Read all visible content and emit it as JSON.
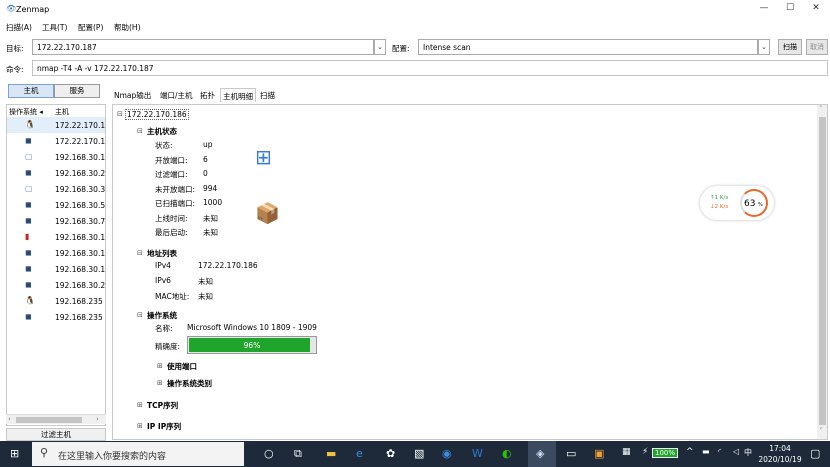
{
  "window": {
    "title": "Zenmap",
    "minimize": "—",
    "maximize": "☐",
    "close": "✕"
  },
  "menu": {
    "scan": "扫描(A)",
    "tools": "工具(T)",
    "profile": "配置(P)",
    "help": "帮助(H)"
  },
  "scanbar": {
    "target_label": "目标:",
    "target_value": "172.22.170.187",
    "profile_label": "配置:",
    "profile_value": "Intense scan",
    "scan_button": "扫描",
    "cancel_button": "取消",
    "command_label": "命令:",
    "command_value": "nmap -T4 -A -v 172.22.170.187"
  },
  "left": {
    "hosts_tab": "主机",
    "services_tab": "服务",
    "col_os": "操作系统",
    "col_host": "主机",
    "hosts": [
      {
        "icon": "linux-icon",
        "glyph": "🐧",
        "ip": "172.22.170.1"
      },
      {
        "icon": "windows-icon",
        "glyph": "◼",
        "ip": "172.22.170.1"
      },
      {
        "icon": "generic-icon",
        "glyph": "▢",
        "ip": "192.168.30.1"
      },
      {
        "icon": "windows-icon",
        "glyph": "◼",
        "ip": "192.168.30.2"
      },
      {
        "icon": "generic-icon",
        "glyph": "▢",
        "ip": "192.168.30.3"
      },
      {
        "icon": "windows-icon",
        "glyph": "◼",
        "ip": "192.168.30.5"
      },
      {
        "icon": "windows-icon",
        "glyph": "◼",
        "ip": "192.168.30.7"
      },
      {
        "icon": "redhat-icon",
        "glyph": "▮",
        "ip": "192.168.30.1"
      },
      {
        "icon": "windows-icon",
        "glyph": "◼",
        "ip": "192.168.30.1"
      },
      {
        "icon": "windows-icon",
        "glyph": "◼",
        "ip": "192.168.30.1"
      },
      {
        "icon": "windows-icon",
        "glyph": "◼",
        "ip": "192.168.30.2"
      },
      {
        "icon": "linux-icon",
        "glyph": "🐧",
        "ip": "192.168.235"
      },
      {
        "icon": "windows-icon",
        "glyph": "◼",
        "ip": "192.168.235"
      }
    ],
    "filter_button": "过滤主机"
  },
  "right": {
    "tabs": [
      "Nmap输出",
      "端口/主机",
      "拓扑",
      "主机明细",
      "扫描"
    ],
    "active_tab": "主机明细",
    "host": "172.22.170.186",
    "status": {
      "heading": "主机状态",
      "rows": [
        {
          "k": "状态:",
          "v": "up"
        },
        {
          "k": "开放端口:",
          "v": "6"
        },
        {
          "k": "过滤端口:",
          "v": "0"
        },
        {
          "k": "未开放端口:",
          "v": "994"
        },
        {
          "k": "已扫描端口:",
          "v": "1000"
        },
        {
          "k": "上线时间:",
          "v": "未知"
        },
        {
          "k": "最后启动:",
          "v": "未知"
        }
      ]
    },
    "addresses": {
      "heading": "地址列表",
      "rows": [
        {
          "k": "IPv4",
          "v": "172.22.170.186"
        },
        {
          "k": "IPv6",
          "v": "未知"
        },
        {
          "k": "MAC地址:",
          "v": "未知"
        }
      ]
    },
    "os": {
      "heading": "操作系统",
      "name_label": "名称:",
      "name_value": "Microsoft Windows 10 1809 - 1909",
      "accuracy_label": "精确度:",
      "accuracy_text": "96%",
      "accuracy_fraction": 0.96,
      "used_ports": "使用端口",
      "os_class": "操作系统类别"
    },
    "tcp_seq": "TCP序列",
    "ipid_seq": "IP IP序列"
  },
  "netwidget": {
    "up": "↑1  K/s",
    "down": "↓2  K/s",
    "percent": "63",
    "unit": "%"
  },
  "taskbar": {
    "search_placeholder": "在这里输入你要搜索的内容",
    "battery": "100%",
    "time": "17:04",
    "date": "2020/10/19"
  },
  "colors": {
    "accent_green": "#1fa52b",
    "taskbar_bg": "#1e2a3a",
    "gauge_orange": "#e8672a"
  }
}
